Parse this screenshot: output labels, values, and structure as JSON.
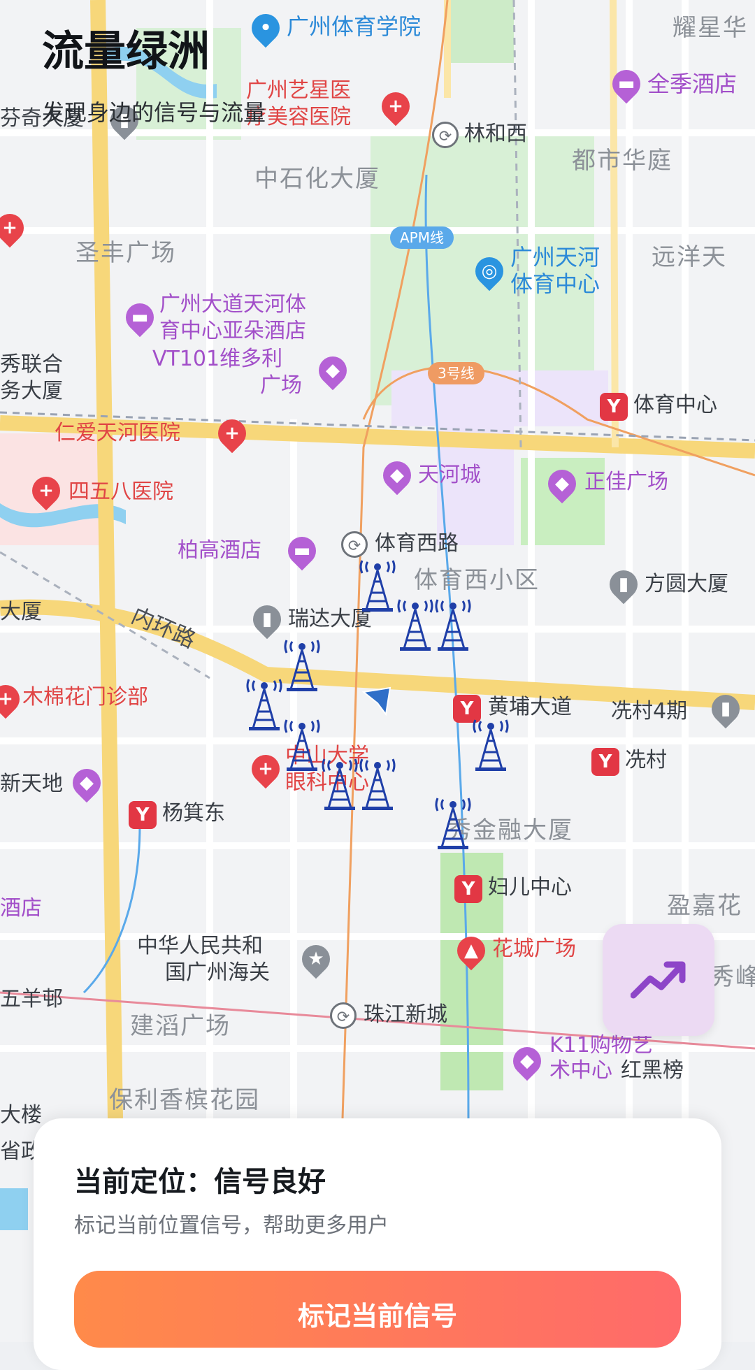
{
  "header": {
    "title": "流量绿洲",
    "subtitle": "发现身边的信号与流量"
  },
  "map": {
    "labels": {
      "sports_college": "广州体育学院",
      "yaoxing": "耀星华",
      "quanji_hotel": "全季酒店",
      "yixing_hospital_1": "广州艺星医",
      "yixing_hospital_2": "疗美容医院",
      "linhexi": "林和西",
      "fenqi": "芬奇大厦",
      "dushi": "都市华庭",
      "zhongshihua": "中石化大厦",
      "apm": "APM线",
      "shengfeng": "圣丰广场",
      "tianhe_sports_1": "广州天河",
      "tianhe_sports_2": "体育中心",
      "yuanyang": "远洋天",
      "yaduo_1": "广州大道天河体",
      "yaduo_2": "育中心亚朵酒店",
      "vt101_1": "VT101维多利",
      "vt101_2": "广场",
      "xiulian_1": "秀联合",
      "xiulian_2": "务大厦",
      "line3": "3号线",
      "tiyu_zhongxin": "体育中心",
      "renai": "仁爱天河医院",
      "tianhecheng": "天河城",
      "zhengjia": "正佳广场",
      "458": "四五八医院",
      "baigao": "柏高酒店",
      "tiyuxilu": "体育西路",
      "tiyuxi_area": "体育西小区",
      "fangyuan": "方圆大厦",
      "dasha_left": "大厦",
      "neihuan": "内环路",
      "ruida": "瑞达大厦",
      "huangpu": "黄埔大道",
      "xiancun4": "冼村4期",
      "mumian": "木棉花门诊部",
      "xiancun": "冼村",
      "zhongshan_1": "中山大学",
      "zhongshan_2": "眼科中心",
      "xintiandi": "新天地",
      "yangjidong": "杨箕东",
      "jinrong": "秀金融大厦",
      "fuer": "妇儿中心",
      "yingjia": "盈嘉花",
      "jiudian_left": "酒店",
      "customs_1": "中华人民共和",
      "customs_2": "国广州海关",
      "huacheng": "花城广场",
      "wuyangcun": "五羊邨",
      "zhujiang": "珠江新城",
      "jiandao": "建滔广场",
      "k11_1": "K11购物艺",
      "k11_2": "术中心",
      "hongheibang": "红黑榜",
      "baoli": "保利香槟花园",
      "dalou": "大楼",
      "shengzheng": "省政",
      "xiufeng": "秀峰"
    }
  },
  "bottom_sheet": {
    "status_title": "当前定位：信号良好",
    "status_desc": "标记当前位置信号，帮助更多用户",
    "cta_label": "标记当前信号"
  },
  "colors": {
    "accent_gradient_start": "#ff8a4a",
    "accent_gradient_end": "#ff6a6a",
    "tower_blue": "#1f3fa8",
    "trend_button_bg": "#ecdaf3"
  },
  "icons": [
    "hospital-icon",
    "hotel-icon",
    "shopping-icon",
    "metro-icon",
    "station-icon",
    "building-icon",
    "signal-tower-icon",
    "trend-icon",
    "location-arrow-icon"
  ]
}
